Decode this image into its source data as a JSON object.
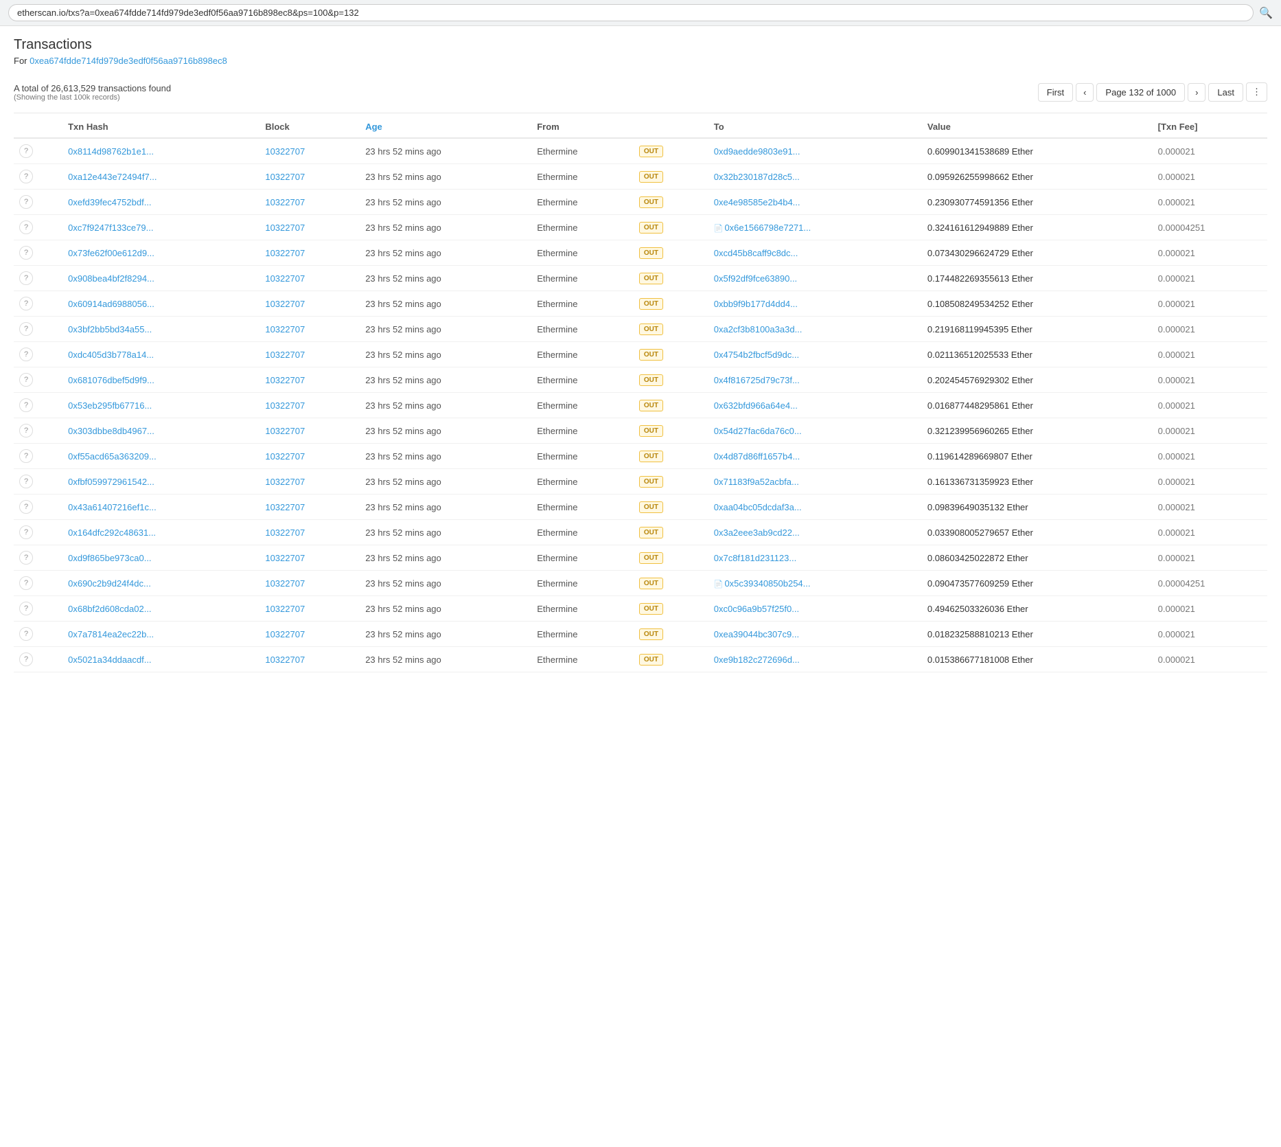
{
  "browser": {
    "url": "etherscan.io/txs?a=0xea674fdde714fd979de3edf0f56aa9716b898ec8&ps=100&p=132",
    "search_icon": "🔍"
  },
  "page": {
    "title": "Transactions",
    "subtitle_prefix": "For ",
    "subtitle_address": "0xea674fdde714fd979de3edf0f56aa9716b898ec8",
    "total_info": "A total of 26,613,529 transactions found",
    "showing_info": "(Showing the last 100k records)"
  },
  "pagination": {
    "first_label": "First",
    "prev_label": "‹",
    "page_info": "Page 132 of 1000",
    "next_label": "›",
    "last_label": "Last",
    "more_label": "⋮"
  },
  "table": {
    "headers": [
      "",
      "Txn Hash",
      "Block",
      "Age",
      "From",
      "",
      "To",
      "Value",
      "[Txn Fee]"
    ],
    "rows": [
      {
        "icon": "?",
        "hash": "0x8114d98762b1e1...",
        "block": "10322707",
        "age": "23 hrs 52 mins ago",
        "from": "Ethermine",
        "direction": "OUT",
        "to": "0xd9aedde9803e91...",
        "to_contract": false,
        "value": "0.609901341538689 Ether",
        "fee": "0.000021"
      },
      {
        "icon": "?",
        "hash": "0xa12e443e72494f7...",
        "block": "10322707",
        "age": "23 hrs 52 mins ago",
        "from": "Ethermine",
        "direction": "OUT",
        "to": "0x32b230187d28c5...",
        "to_contract": false,
        "value": "0.095926255998662 Ether",
        "fee": "0.000021"
      },
      {
        "icon": "?",
        "hash": "0xefd39fec4752bdf...",
        "block": "10322707",
        "age": "23 hrs 52 mins ago",
        "from": "Ethermine",
        "direction": "OUT",
        "to": "0xe4e98585e2b4b4...",
        "to_contract": false,
        "value": "0.230930774591356 Ether",
        "fee": "0.000021"
      },
      {
        "icon": "?",
        "hash": "0xc7f9247f133ce79...",
        "block": "10322707",
        "age": "23 hrs 52 mins ago",
        "from": "Ethermine",
        "direction": "OUT",
        "to": "0x6e1566798e7271...",
        "to_contract": true,
        "value": "0.324161612949889 Ether",
        "fee": "0.00004251"
      },
      {
        "icon": "?",
        "hash": "0x73fe62f00e612d9...",
        "block": "10322707",
        "age": "23 hrs 52 mins ago",
        "from": "Ethermine",
        "direction": "OUT",
        "to": "0xcd45b8caff9c8dc...",
        "to_contract": false,
        "value": "0.073430296624729 Ether",
        "fee": "0.000021"
      },
      {
        "icon": "?",
        "hash": "0x908bea4bf2f8294...",
        "block": "10322707",
        "age": "23 hrs 52 mins ago",
        "from": "Ethermine",
        "direction": "OUT",
        "to": "0x5f92df9fce63890...",
        "to_contract": false,
        "value": "0.174482269355613 Ether",
        "fee": "0.000021"
      },
      {
        "icon": "?",
        "hash": "0x60914ad6988056...",
        "block": "10322707",
        "age": "23 hrs 52 mins ago",
        "from": "Ethermine",
        "direction": "OUT",
        "to": "0xbb9f9b177d4dd4...",
        "to_contract": false,
        "value": "0.108508249534252 Ether",
        "fee": "0.000021"
      },
      {
        "icon": "?",
        "hash": "0x3bf2bb5bd34a55...",
        "block": "10322707",
        "age": "23 hrs 52 mins ago",
        "from": "Ethermine",
        "direction": "OUT",
        "to": "0xa2cf3b8100a3a3d...",
        "to_contract": false,
        "value": "0.219168119945395 Ether",
        "fee": "0.000021"
      },
      {
        "icon": "?",
        "hash": "0xdc405d3b778a14...",
        "block": "10322707",
        "age": "23 hrs 52 mins ago",
        "from": "Ethermine",
        "direction": "OUT",
        "to": "0x4754b2fbcf5d9dc...",
        "to_contract": false,
        "value": "0.021136512025533 Ether",
        "fee": "0.000021"
      },
      {
        "icon": "?",
        "hash": "0x681076dbef5d9f9...",
        "block": "10322707",
        "age": "23 hrs 52 mins ago",
        "from": "Ethermine",
        "direction": "OUT",
        "to": "0x4f816725d79c73f...",
        "to_contract": false,
        "value": "0.202454576929302 Ether",
        "fee": "0.000021"
      },
      {
        "icon": "?",
        "hash": "0x53eb295fb67716...",
        "block": "10322707",
        "age": "23 hrs 52 mins ago",
        "from": "Ethermine",
        "direction": "OUT",
        "to": "0x632bfd966a64e4...",
        "to_contract": false,
        "value": "0.016877448295861 Ether",
        "fee": "0.000021"
      },
      {
        "icon": "?",
        "hash": "0x303dbbe8db4967...",
        "block": "10322707",
        "age": "23 hrs 52 mins ago",
        "from": "Ethermine",
        "direction": "OUT",
        "to": "0x54d27fac6da76c0...",
        "to_contract": false,
        "value": "0.321239956960265 Ether",
        "fee": "0.000021"
      },
      {
        "icon": "?",
        "hash": "0xf55acd65a363209...",
        "block": "10322707",
        "age": "23 hrs 52 mins ago",
        "from": "Ethermine",
        "direction": "OUT",
        "to": "0x4d87d86ff1657b4...",
        "to_contract": false,
        "value": "0.119614289669807 Ether",
        "fee": "0.000021"
      },
      {
        "icon": "?",
        "hash": "0xfbf059972961542...",
        "block": "10322707",
        "age": "23 hrs 52 mins ago",
        "from": "Ethermine",
        "direction": "OUT",
        "to": "0x71183f9a52acbfa...",
        "to_contract": false,
        "value": "0.161336731359923 Ether",
        "fee": "0.000021"
      },
      {
        "icon": "?",
        "hash": "0x43a61407216ef1c...",
        "block": "10322707",
        "age": "23 hrs 52 mins ago",
        "from": "Ethermine",
        "direction": "OUT",
        "to": "0xaa04bc05dcdaf3a...",
        "to_contract": false,
        "value": "0.09839649035132 Ether",
        "fee": "0.000021"
      },
      {
        "icon": "?",
        "hash": "0x164dfc292c48631...",
        "block": "10322707",
        "age": "23 hrs 52 mins ago",
        "from": "Ethermine",
        "direction": "OUT",
        "to": "0x3a2eee3ab9cd22...",
        "to_contract": false,
        "value": "0.033908005279657 Ether",
        "fee": "0.000021"
      },
      {
        "icon": "?",
        "hash": "0xd9f865be973ca0...",
        "block": "10322707",
        "age": "23 hrs 52 mins ago",
        "from": "Ethermine",
        "direction": "OUT",
        "to": "0x7c8f181d231123...",
        "to_contract": false,
        "value": "0.08603425022872 Ether",
        "fee": "0.000021"
      },
      {
        "icon": "?",
        "hash": "0x690c2b9d24f4dc...",
        "block": "10322707",
        "age": "23 hrs 52 mins ago",
        "from": "Ethermine",
        "direction": "OUT",
        "to": "0x5c39340850b254...",
        "to_contract": true,
        "value": "0.090473577609259 Ether",
        "fee": "0.00004251"
      },
      {
        "icon": "?",
        "hash": "0x68bf2d608cda02...",
        "block": "10322707",
        "age": "23 hrs 52 mins ago",
        "from": "Ethermine",
        "direction": "OUT",
        "to": "0xc0c96a9b57f25f0...",
        "to_contract": false,
        "value": "0.49462503326036 Ether",
        "fee": "0.000021"
      },
      {
        "icon": "?",
        "hash": "0x7a7814ea2ec22b...",
        "block": "10322707",
        "age": "23 hrs 52 mins ago",
        "from": "Ethermine",
        "direction": "OUT",
        "to": "0xea39044bc307c9...",
        "to_contract": false,
        "value": "0.018232588810213 Ether",
        "fee": "0.000021"
      },
      {
        "icon": "?",
        "hash": "0x5021a34ddaacdf...",
        "block": "10322707",
        "age": "23 hrs 52 mins ago",
        "from": "Ethermine",
        "direction": "OUT",
        "to": "0xe9b182c272696d...",
        "to_contract": false,
        "value": "0.015386677181008 Ether",
        "fee": "0.000021"
      }
    ]
  }
}
